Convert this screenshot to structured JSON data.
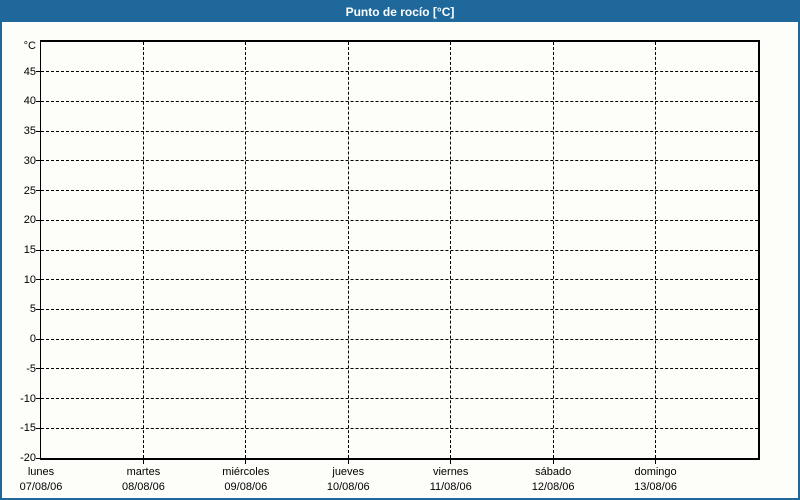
{
  "window": {
    "title": "Punto de rocío [°C]"
  },
  "colors": {
    "accent_blue": "#1e689c",
    "title_text": "#ffffff",
    "grid": "#000000",
    "background": "#fdfdf9"
  },
  "chart_data": {
    "type": "line",
    "title": "Punto de rocío [°C]",
    "xlabel": "",
    "ylabel": "°C",
    "ylim": [
      -20,
      50
    ],
    "y_tick_labels": [
      45,
      40,
      35,
      30,
      25,
      20,
      15,
      10,
      5,
      0,
      -5,
      -10,
      -15,
      -20
    ],
    "grid": "dashed",
    "legend_position": "none",
    "x_days": [
      {
        "name": "lunes",
        "date": "07/08/06"
      },
      {
        "name": "martes",
        "date": "08/08/06"
      },
      {
        "name": "miércoles",
        "date": "09/08/06"
      },
      {
        "name": "jueves",
        "date": "10/08/06"
      },
      {
        "name": "viernes",
        "date": "11/08/06"
      },
      {
        "name": "sábado",
        "date": "12/08/06"
      },
      {
        "name": "domingo",
        "date": "13/08/06"
      }
    ],
    "series": []
  }
}
